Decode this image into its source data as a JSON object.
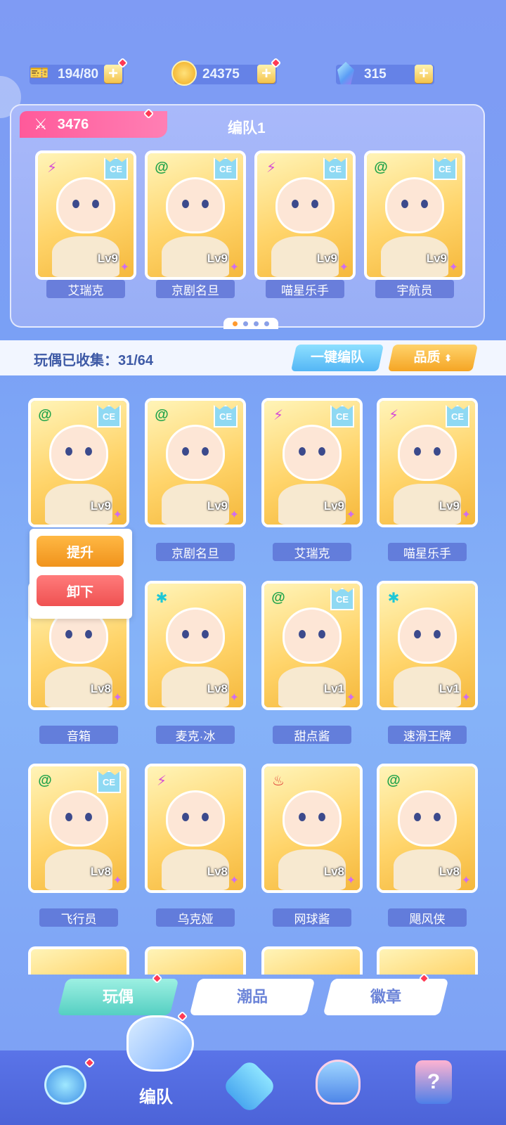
{
  "currency": {
    "stamina": "194/80",
    "coins": "24375",
    "gems": "315"
  },
  "team": {
    "power": "3476",
    "title": "编队1",
    "members": [
      {
        "name": "艾瑞克",
        "level": "Lv9",
        "attr": "lightning",
        "ce": "CE"
      },
      {
        "name": "京剧名旦",
        "level": "Lv9",
        "attr": "spiral",
        "ce": "CE"
      },
      {
        "name": "喵星乐手",
        "level": "Lv9",
        "attr": "lightning",
        "ce": "CE"
      },
      {
        "name": "宇航员",
        "level": "Lv9",
        "attr": "spiral",
        "ce": "CE"
      }
    ]
  },
  "collection": {
    "label": "玩偶已收集：31/64",
    "quick_team": "一键编队",
    "quality": "品质"
  },
  "popup": {
    "upgrade": "提升",
    "remove": "卸下"
  },
  "grid": [
    {
      "name": "",
      "level": "Lv9",
      "attr": "spiral",
      "ce": "CE"
    },
    {
      "name": "京剧名旦",
      "level": "Lv9",
      "attr": "spiral",
      "ce": "CE"
    },
    {
      "name": "艾瑞克",
      "level": "Lv9",
      "attr": "lightning",
      "ce": "CE"
    },
    {
      "name": "喵星乐手",
      "level": "Lv9",
      "attr": "lightning",
      "ce": "CE"
    },
    {
      "name": "音箱",
      "level": "Lv8",
      "attr": "",
      "ce": ""
    },
    {
      "name": "麦克·冰",
      "level": "Lv8",
      "attr": "snowflake",
      "ce": ""
    },
    {
      "name": "甜点酱",
      "level": "Lv1",
      "attr": "spiral",
      "ce": "CE"
    },
    {
      "name": "速滑王牌",
      "level": "Lv1",
      "attr": "snowflake",
      "ce": ""
    },
    {
      "name": "飞行员",
      "level": "Lv8",
      "attr": "spiral",
      "ce": "CE"
    },
    {
      "name": "乌克娅",
      "level": "Lv8",
      "attr": "lightning",
      "ce": ""
    },
    {
      "name": "网球酱",
      "level": "Lv8",
      "attr": "fire",
      "ce": ""
    },
    {
      "name": "飓风侠",
      "level": "Lv8",
      "attr": "spiral",
      "ce": ""
    }
  ],
  "tabs": {
    "dolls": "玩偶",
    "trendy": "潮品",
    "badges": "徽章"
  },
  "nav": {
    "team": "编队"
  },
  "colors": {
    "lightning": "#d64bd6",
    "spiral": "#1fa34a",
    "snowflake": "#1ec7d6",
    "fire": "#e0413a"
  }
}
